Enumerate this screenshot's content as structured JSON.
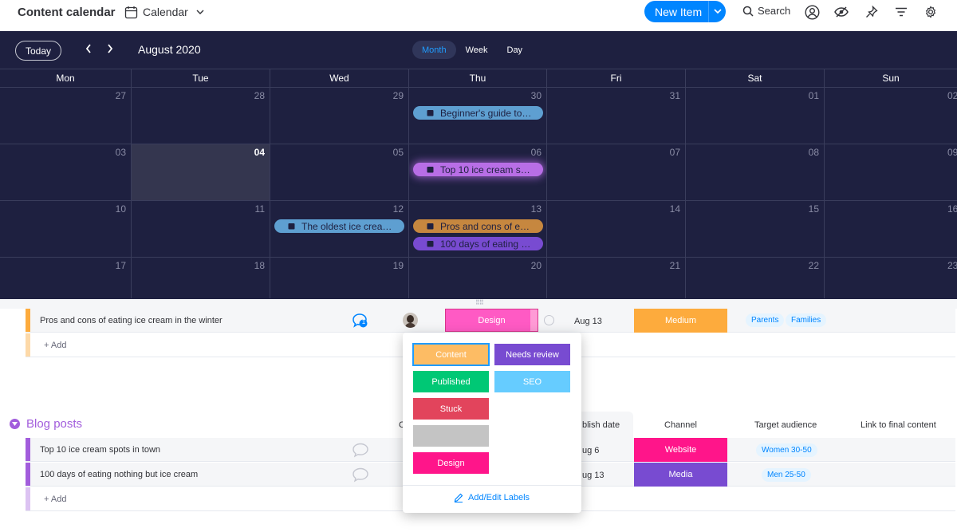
{
  "header": {
    "board_title": "Content calendar",
    "view_name": "Calendar",
    "new_item_label": "New Item",
    "search_label": "Search"
  },
  "calendar": {
    "today_label": "Today",
    "month_label": "August 2020",
    "range_tabs": [
      "Month",
      "Week",
      "Day"
    ],
    "active_tab": "Month",
    "weekdays": [
      "Mon",
      "Tue",
      "Wed",
      "Thu",
      "Fri",
      "Sat",
      "Sun"
    ],
    "weeks": [
      [
        "27",
        "28",
        "29",
        "30",
        "31",
        "01",
        "02"
      ],
      [
        "03",
        "04",
        "05",
        "06",
        "07",
        "08",
        "09"
      ],
      [
        "10",
        "11",
        "12",
        "13",
        "14",
        "15",
        "16"
      ],
      [
        "17",
        "18",
        "19",
        "20",
        "21",
        "22",
        "23"
      ]
    ],
    "events": {
      "beginners_guide": "Beginner's guide to…",
      "top10": "Top 10 ice cream s…",
      "oldest": "The oldest ice crea…",
      "pros_cons": "Pros and cons of e…",
      "days100": "100 days of eating …"
    },
    "event_colors": {
      "blue": "#5e9fd1",
      "purple_glow": "#b86ee6",
      "orange": "#c6873f",
      "violet": "#784bd1"
    }
  },
  "board": {
    "top_row": {
      "name": "Pros and cons of eating ice cream in the winter",
      "status": "Design",
      "date": "Aug 13",
      "priority": "Medium",
      "audience_tags": [
        "Parents",
        "Families"
      ],
      "update_count": "1"
    },
    "add_label": "+ Add",
    "group_title": "Blog posts",
    "columns": {
      "c_partial": "C",
      "publish_date_partial": "blish date",
      "channel": "Channel",
      "target_audience": "Target audience",
      "link": "Link to final content"
    },
    "rows": [
      {
        "name": "Top 10 ice cream spots in town",
        "date_partial": "ug 6",
        "channel": "Website",
        "audience": "Women 30-50"
      },
      {
        "name": "100 days of eating nothing but ice cream",
        "date_partial": "ug 13",
        "channel": "Media",
        "audience": "Men 25-50"
      }
    ]
  },
  "label_picker": {
    "labels": [
      {
        "text": "Content",
        "color": "#fdbc64"
      },
      {
        "text": "Needs review",
        "color": "#784bd1"
      },
      {
        "text": "Published",
        "color": "#00c875"
      },
      {
        "text": "SEO",
        "color": "#66ccff"
      },
      {
        "text": "Stuck",
        "color": "#e2445c"
      },
      {
        "text": "",
        "color": "#c4c4c4"
      },
      {
        "text": "Design",
        "color": "#ff158a"
      }
    ],
    "edit_label": "Add/Edit Labels"
  },
  "colors": {
    "accent": "#0085ff",
    "calendar_bg": "#1e2040",
    "priority_medium": "#fdab3d",
    "channel_website": "#ff158a",
    "channel_media": "#784bd1",
    "group_purple": "#a25ddc",
    "status_design": "#ff5ac4"
  }
}
